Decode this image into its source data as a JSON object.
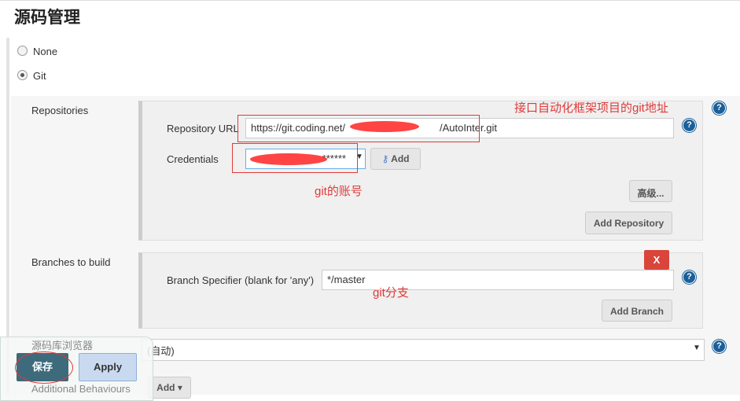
{
  "section_title": "源码管理",
  "scm_options": [
    {
      "label": "None",
      "selected": false
    },
    {
      "label": "Git",
      "selected": true
    }
  ],
  "repositories": {
    "label": "Repositories",
    "url_label": "Repository URL",
    "url_value": "https://git.coding.net/",
    "url_suffix": "/AutoInter.git",
    "credentials_label": "Credentials",
    "credentials_value": "******",
    "add_label": "Add",
    "advanced_label": "高级...",
    "add_repository_label": "Add Repository"
  },
  "branches": {
    "label": "Branches to build",
    "specifier_label": "Branch Specifier (blank for 'any')",
    "specifier_value": "*/master",
    "delete_label": "X",
    "add_branch_label": "Add Branch"
  },
  "browser": {
    "label": "源码库浏览器",
    "value": "(自动)"
  },
  "additional": {
    "label": "Additional Behaviours",
    "add_label": "Add"
  },
  "annotations": {
    "repo": "接口自动化框架项目的git地址",
    "account": "git的账号",
    "branch": "git分支"
  },
  "footer": {
    "save_label": "保存",
    "apply_label": "Apply"
  },
  "colors": {
    "annotation": "#e03a3a",
    "save": "#3d6b7b",
    "help": "#1b5f9a",
    "delete": "#d9453b"
  }
}
